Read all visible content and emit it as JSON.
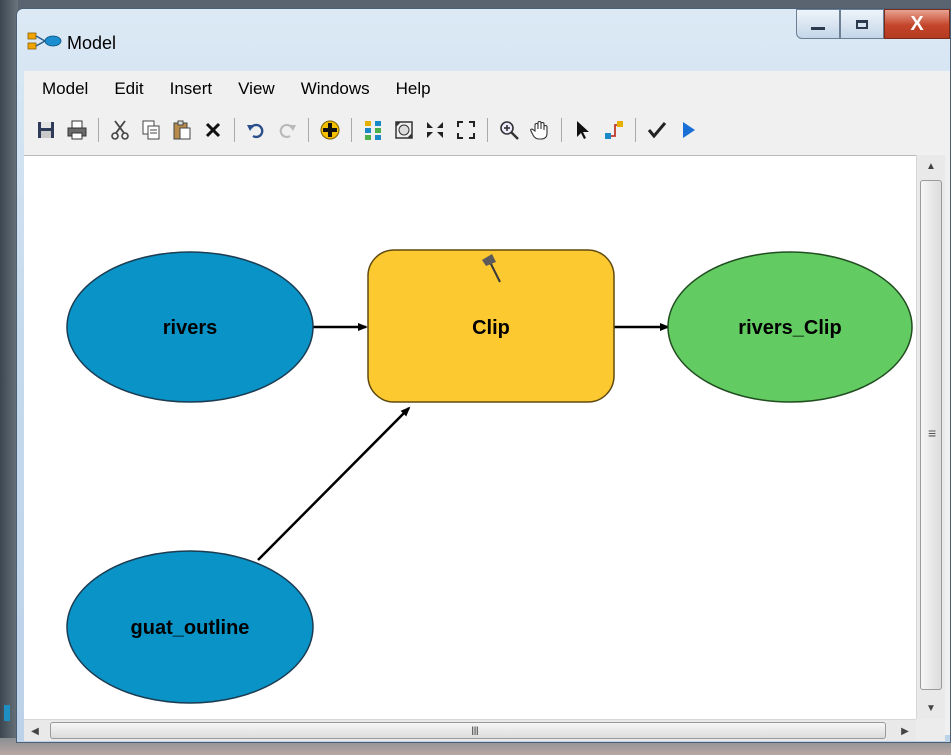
{
  "window": {
    "title": "Model",
    "controls": {
      "minimize_icon": "minimize-icon",
      "maximize_icon": "maximize-icon",
      "close_label": "X"
    }
  },
  "menubar": {
    "items": [
      "Model",
      "Edit",
      "Insert",
      "View",
      "Windows",
      "Help"
    ]
  },
  "toolbar": {
    "icons": [
      "save-icon",
      "print-icon",
      "cut-icon",
      "copy-icon",
      "paste-icon",
      "delete-icon",
      "undo-icon",
      "redo-icon",
      "add-data-icon",
      "auto-layout-icon",
      "full-extent-icon",
      "fixed-zoom-in-icon",
      "fixed-zoom-out-icon",
      "zoom-in-icon",
      "pan-icon",
      "select-icon",
      "connect-icon",
      "validate-icon",
      "run-icon"
    ]
  },
  "diagram": {
    "nodes": {
      "rivers": {
        "label": "rivers",
        "kind": "input-data",
        "color": "#0a93c6"
      },
      "clip": {
        "label": "Clip",
        "kind": "tool",
        "color": "#fdc930",
        "icon": "hammer-icon"
      },
      "rivers_clip": {
        "label": "rivers_Clip",
        "kind": "output-data",
        "color": "#62cc62"
      },
      "guat_outline": {
        "label": "guat_outline",
        "kind": "input-data",
        "color": "#0a93c6"
      }
    },
    "connections": [
      {
        "from": "rivers",
        "to": "Clip"
      },
      {
        "from": "guat_outline",
        "to": "Clip"
      },
      {
        "from": "Clip",
        "to": "rivers_Clip"
      }
    ]
  },
  "scrollbars": {
    "horizontal_grip": "III",
    "vertical_grip": "≡"
  }
}
